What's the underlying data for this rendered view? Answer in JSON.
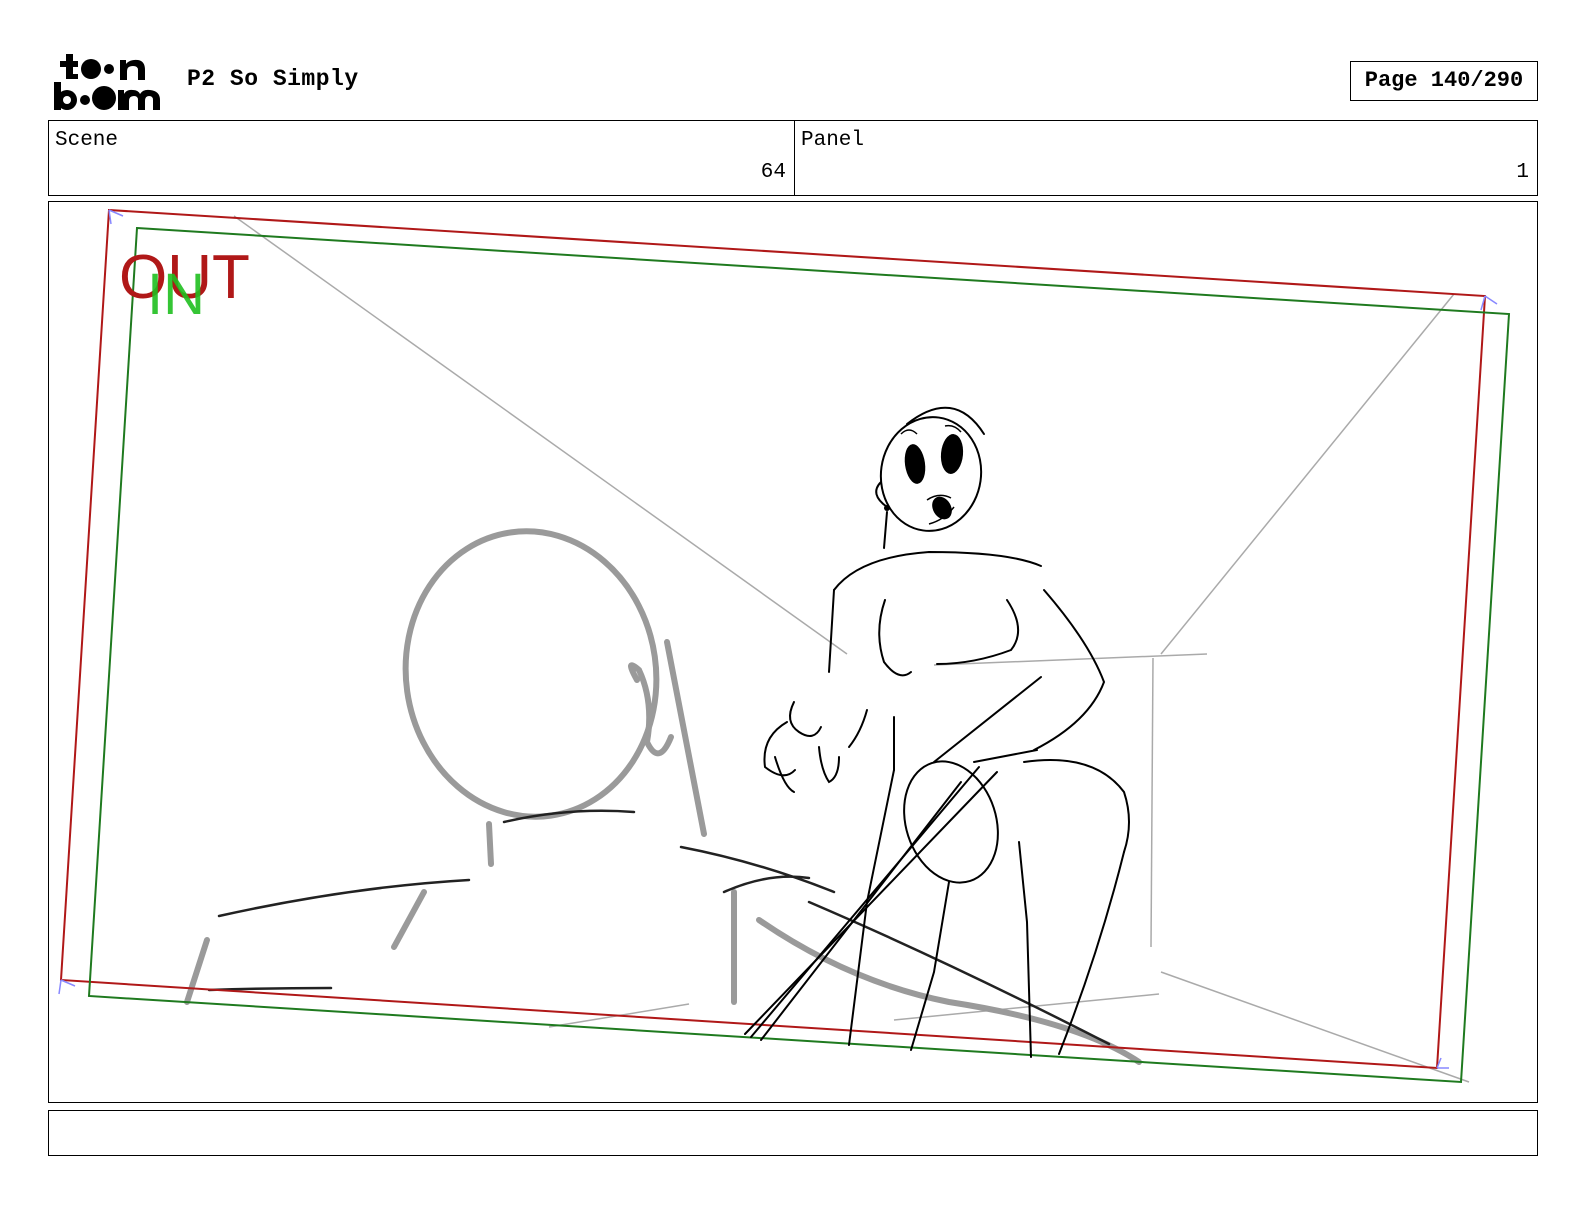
{
  "logo": {
    "line1": "toon",
    "line2": "boom"
  },
  "header": {
    "project_title": "P2 So Simply",
    "page_label": "Page 140/290"
  },
  "scene": {
    "label": "Scene",
    "value": "64"
  },
  "panel": {
    "label": "Panel",
    "value": "1"
  },
  "camera": {
    "out_label": "OUT",
    "in_label": "IN",
    "out_color": "#b01818",
    "in_color": "#1f7a1f",
    "in_text_color": "#1fbf1f"
  },
  "notes": {
    "text": ""
  }
}
